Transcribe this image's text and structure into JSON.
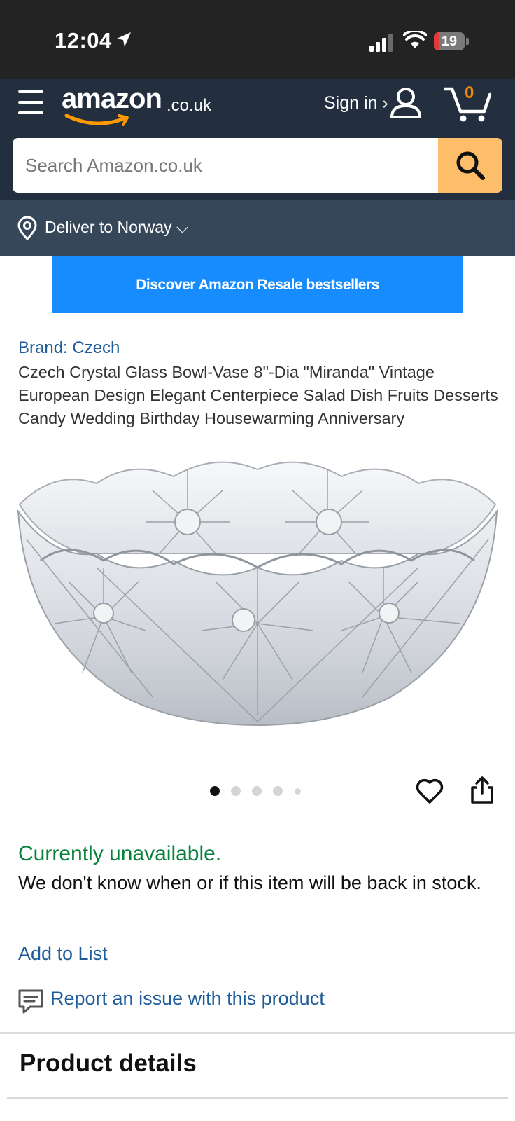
{
  "status_bar": {
    "time": "12:04",
    "battery": "19",
    "battery_level": 0.19
  },
  "header": {
    "logo_text": "amazon",
    "logo_tld": ".co.uk",
    "sign_in": "Sign in ›",
    "cart_count": "0"
  },
  "search": {
    "placeholder": "Search Amazon.co.uk"
  },
  "delivery": {
    "text": "Deliver to Norway ⌵"
  },
  "banner": {
    "text": "Discover Amazon Resale bestsellers"
  },
  "product": {
    "brand": "Brand: Czech",
    "title": "Czech Crystal Glass Bowl-Vase 8\"-Dia \"Miranda\" Vintage European Design Elegant Centerpiece Salad Dish Fruits Desserts Candy Wedding Birthday Housewarming Anniversary",
    "image_count": 5,
    "active_image": 1
  },
  "availability": {
    "status": "Currently unavailable.",
    "message": "We don't know when or if this item will be back in stock."
  },
  "actions": {
    "add_to_list": "Add to List",
    "report": "Report an issue with this product"
  },
  "sections": {
    "product_details": "Product details"
  },
  "colors": {
    "header": "#232f3e",
    "deliver_bar": "#37475a",
    "search_button": "#febd69",
    "banner": "#168cfe",
    "link": "#1f5c99",
    "unavailable": "#087f3b",
    "cart_count": "#f08804"
  }
}
